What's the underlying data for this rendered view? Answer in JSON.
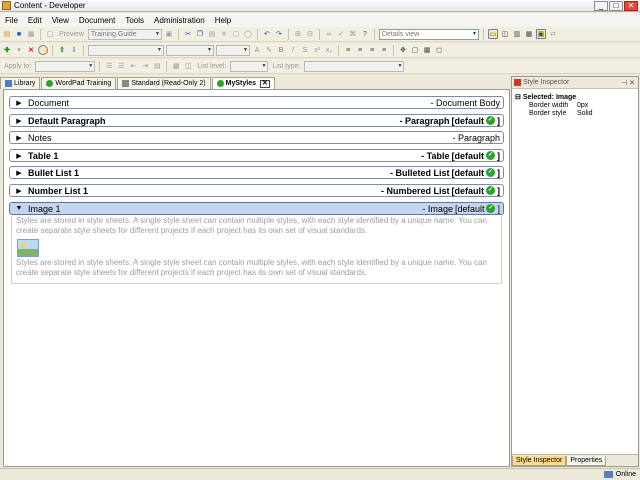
{
  "window": {
    "title": "Content - Developer"
  },
  "menu": [
    "File",
    "Edit",
    "View",
    "Document",
    "Tools",
    "Administration",
    "Help"
  ],
  "toolbar": {
    "preview_label": "Preview",
    "profile_combo": "Training Guide",
    "view_combo": "Details view",
    "apply_to_label": "Apply to:",
    "list_level_label": "List level:",
    "list_type_label": "List type:"
  },
  "tabs": [
    {
      "label": "Library"
    },
    {
      "label": "WordPad Training"
    },
    {
      "label": "Standard (Read-Only 2)"
    },
    {
      "label": "MyStyles"
    }
  ],
  "styles": [
    {
      "name": "Document",
      "type": "- Document Body",
      "default": ""
    },
    {
      "name": "Default Paragraph",
      "type": "- Paragraph",
      "default": "[default"
    },
    {
      "name": "Notes",
      "type": "- Paragraph",
      "default": ""
    },
    {
      "name": "Table 1",
      "type": "- Table",
      "default": "[default"
    },
    {
      "name": "Bullet List 1",
      "type": "- Bulleted List",
      "default": "[default"
    },
    {
      "name": "Number List 1",
      "type": "- Numbered List",
      "default": "[default"
    },
    {
      "name": "Image 1",
      "type": "- Image",
      "default": "[default"
    }
  ],
  "sample_text": "Styles are stored in style sheets. A single style sheet can contain multiple styles, with each style identified by a unique name. You can create separate style sheets for different projects if each project has its own set of visual standards.",
  "inspector": {
    "title": "Style Inspector",
    "selected": "Selected: Image",
    "rows": [
      {
        "key": "Border width",
        "value": "0px"
      },
      {
        "key": "Border style",
        "value": "Solid"
      }
    ],
    "tabs": [
      "Style Inspector",
      "Properties"
    ]
  },
  "status": {
    "online": "Online"
  },
  "icons": [
    "app-icon",
    "minimize-icon",
    "maximize-icon",
    "close-icon",
    "check-icon",
    "expand-arrow-icon",
    "collapse-arrow-icon",
    "image-icon",
    "pin-icon",
    "network-icon"
  ]
}
